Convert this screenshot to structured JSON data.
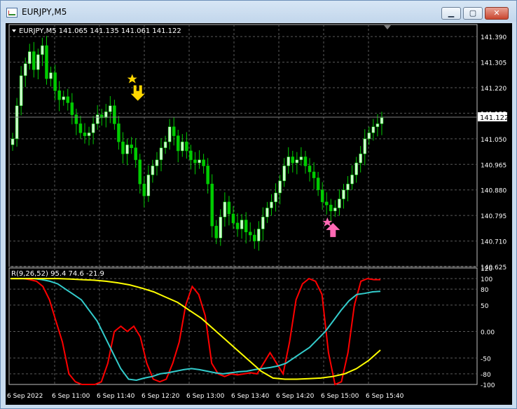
{
  "window": {
    "title": "EURJPY,M5",
    "minimize_glyph": "▁",
    "maximize_glyph": "▢",
    "close_glyph": "✕"
  },
  "main_chart": {
    "header": "EURJPY,M5  141.065 141.135 141.061 141.122",
    "price_label": "141.122",
    "price_current": 141.122,
    "y_ticks": [
      "141.390",
      "141.305",
      "141.220",
      "141.135",
      "141.050",
      "140.965",
      "140.880",
      "140.795",
      "140.710",
      "140.625"
    ],
    "colors": {
      "bull": "#ccffcc",
      "bear": "#00cc00",
      "grid": "#c0c0c0",
      "up_arrow": "#ff69b4",
      "down_arrow": "#ffd700"
    }
  },
  "indicator": {
    "header": "R(9,26,52) 95.4 74.6 -21.9",
    "y_ticks": [
      "120",
      "100",
      "80",
      "50",
      "0.00",
      "-50",
      "-80",
      "-100"
    ],
    "colors": {
      "fast": "#ff0000",
      "mid": "#33cccc",
      "slow": "#ffff00"
    }
  },
  "x_ticks": [
    "6 Sep 2022",
    "6 Sep 11:00",
    "6 Sep 11:40",
    "6 Sep 12:20",
    "6 Sep 13:00",
    "6 Sep 13:40",
    "6 Sep 14:20",
    "6 Sep 15:00",
    "6 Sep 15:40"
  ],
  "chart_data": {
    "type": "line",
    "symbol": "EURJPY",
    "timeframe": "M5",
    "price_range": [
      140.625,
      141.43
    ],
    "candles_close": [
      141.05,
      141.16,
      141.26,
      141.3,
      141.34,
      141.28,
      141.33,
      141.36,
      141.25,
      141.27,
      141.21,
      141.18,
      141.19,
      141.17,
      141.13,
      141.1,
      141.07,
      141.06,
      141.07,
      141.1,
      141.13,
      141.12,
      141.14,
      141.16,
      141.1,
      141.04,
      141.0,
      141.03,
      141.02,
      140.98,
      140.9,
      140.86,
      140.93,
      140.96,
      140.98,
      141.02,
      141.04,
      141.09,
      141.06,
      141.01,
      141.04,
      141.01,
      140.98,
      140.97,
      140.98,
      140.96,
      140.9,
      140.76,
      140.72,
      140.79,
      140.84,
      140.8,
      140.77,
      140.75,
      140.78,
      140.74,
      140.73,
      140.71,
      140.75,
      140.79,
      140.82,
      140.84,
      140.87,
      140.91,
      140.96,
      140.99,
      140.97,
      140.98,
      140.99,
      140.96,
      140.94,
      140.92,
      140.88,
      140.84,
      140.83,
      140.81,
      140.82,
      140.85,
      140.88,
      140.9,
      140.93,
      140.97,
      141.0,
      141.05,
      141.07,
      141.09,
      141.1,
      141.12
    ],
    "indicator": {
      "name": "R(9,26,52)",
      "last_values": {
        "fast": 95.4,
        "mid": 74.6,
        "slow": -21.9
      },
      "range": [
        -100,
        120
      ],
      "series": [
        {
          "name": "fast",
          "values": [
            100,
            100,
            100,
            98,
            95,
            85,
            60,
            20,
            -20,
            -80,
            -95,
            -100,
            -100,
            -100,
            -95,
            -60,
            0,
            10,
            0,
            10,
            -10,
            -60,
            -90,
            -95,
            -90,
            -60,
            -20,
            50,
            85,
            70,
            30,
            -60,
            -80,
            -85,
            -80,
            -82,
            -80,
            -78,
            -80,
            -60,
            -40,
            -60,
            -80,
            -20,
            60,
            90,
            100,
            95,
            70,
            -40,
            -100,
            -95,
            -40,
            50,
            95,
            100,
            98,
            98
          ]
        },
        {
          "name": "mid",
          "values": [
            100,
            100,
            100,
            100,
            98,
            95,
            90,
            80,
            70,
            60,
            40,
            20,
            -10,
            -40,
            -70,
            -90,
            -92,
            -88,
            -85,
            -80,
            -78,
            -75,
            -72,
            -70,
            -72,
            -75,
            -78,
            -80,
            -78,
            -76,
            -75,
            -72,
            -70,
            -68,
            -65,
            -60,
            -50,
            -40,
            -30,
            -15,
            0,
            20,
            40,
            58,
            70,
            72,
            75,
            76
          ]
        },
        {
          "name": "slow",
          "values": [
            100,
            100,
            100,
            100,
            100,
            99,
            98,
            97,
            95,
            92,
            88,
            82,
            75,
            65,
            55,
            40,
            25,
            5,
            -15,
            -35,
            -55,
            -75,
            -88,
            -90,
            -90,
            -89,
            -88,
            -85,
            -80,
            -70,
            -55,
            -35
          ]
        }
      ]
    },
    "signals": [
      {
        "type": "sell",
        "price": 141.2
      },
      {
        "type": "buy",
        "price": 140.77
      }
    ]
  }
}
